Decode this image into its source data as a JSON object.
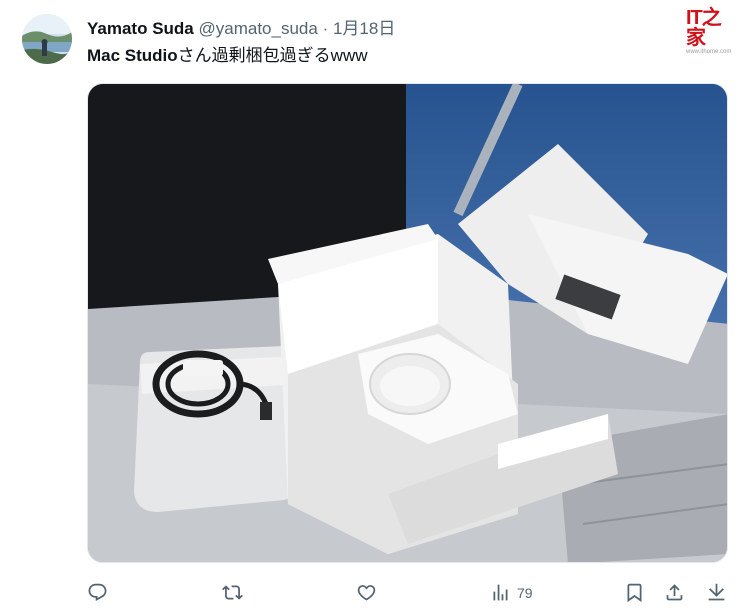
{
  "tweet": {
    "display_name": "Yamato Suda",
    "handle": "@yamato_suda",
    "separator": "·",
    "date": "1月18日",
    "text_bold": "Mac Studio",
    "text_rest": "さん過剰梱包過ぎるwww",
    "views_count": "79"
  },
  "watermark": {
    "logo": "IT之家",
    "url": "www.ithome.com"
  },
  "icons": {
    "reply": "reply-icon",
    "retweet": "retweet-icon",
    "like": "heart-icon",
    "views": "analytics-icon",
    "bookmark": "bookmark-icon",
    "share": "share-icon",
    "download": "download-icon"
  },
  "colors": {
    "text_primary": "#0f1419",
    "text_secondary": "#536471",
    "watermark_red": "#d0121b"
  }
}
